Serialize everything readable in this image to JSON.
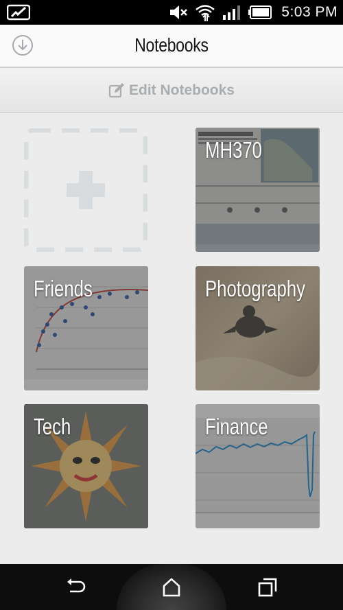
{
  "status_bar": {
    "time": "5:03 PM",
    "icons": [
      "notes-app-icon",
      "mute-icon",
      "wifi-icon",
      "signal-icon",
      "battery-icon"
    ]
  },
  "header": {
    "title": "Notebooks",
    "download_icon": "download-icon"
  },
  "edit_bar": {
    "label": "Edit Notebooks",
    "icon": "edit-icon"
  },
  "add_notebook": {
    "icon": "plus-icon"
  },
  "notebooks": [
    {
      "name": "MH370",
      "thumbnail": "infographic"
    },
    {
      "name": "Friends",
      "thumbnail": "scatter-chart"
    },
    {
      "name": "Photography",
      "thumbnail": "turtle-on-sand"
    },
    {
      "name": "Tech",
      "thumbnail": "sun-mosaic"
    },
    {
      "name": "Finance",
      "thumbnail": "stock-chart"
    }
  ],
  "nav_bar": {
    "icons": [
      "back-icon",
      "home-icon",
      "recent-apps-icon"
    ]
  },
  "colors": {
    "accent_gray": "#a9adb0",
    "background": "#ececec",
    "status_bar": "#000000"
  }
}
